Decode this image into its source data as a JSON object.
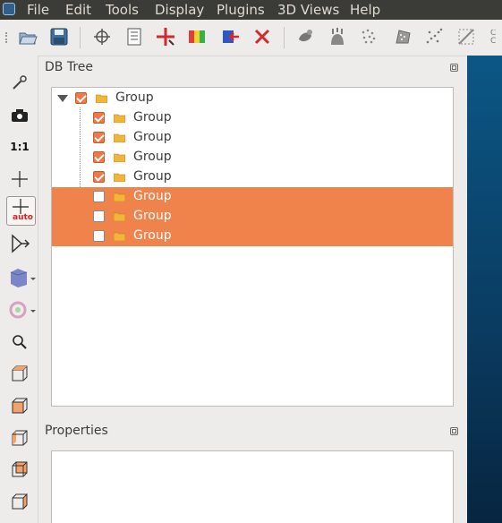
{
  "menubar": {
    "items": [
      "File",
      "Edit",
      "Tools",
      "Display",
      "Plugins",
      "3D Views",
      "Help"
    ]
  },
  "toolbar": {
    "icons": [
      "open-icon",
      "save-icon",
      "pick-rotation-center-icon",
      "list-icon",
      "translate-rotate-icon",
      "color-scale-icon",
      "clone-icon",
      "delete-icon",
      "sample-points-icon",
      "normals-icon",
      "subsample-icon",
      "mesh-icon",
      "noise-filter-icon",
      "crop-icon"
    ],
    "cut_label": "C C"
  },
  "left_toolbar": {
    "icons": [
      "wrench-icon",
      "camera-icon",
      "zoom-1to1-icon",
      "center-cross-icon",
      "auto-center-icon",
      "viewing-direction-icon",
      "perspective-cube-icon",
      "lighting-icon",
      "zoom-icon",
      "top-view-icon",
      "front-view-icon",
      "left-view-icon",
      "back-view-icon",
      "right-view-icon"
    ],
    "one_to_one_label": "1:1",
    "auto_label": "auto"
  },
  "db_tree": {
    "title": "DB Tree",
    "root": {
      "label": "Group",
      "checked": true,
      "expanded": true
    },
    "children": [
      {
        "label": "Group",
        "checked": true,
        "selected": false
      },
      {
        "label": "Group",
        "checked": true,
        "selected": false
      },
      {
        "label": "Group",
        "checked": true,
        "selected": false
      },
      {
        "label": "Group",
        "checked": true,
        "selected": false
      },
      {
        "label": "Group",
        "checked": false,
        "selected": true
      },
      {
        "label": "Group",
        "checked": false,
        "selected": true
      },
      {
        "label": "Group",
        "checked": false,
        "selected": true
      }
    ]
  },
  "properties": {
    "title": "Properties"
  },
  "colors": {
    "accent": "#f0824c",
    "menubar": "#3b3b37",
    "view_bg": "#0b5785"
  }
}
